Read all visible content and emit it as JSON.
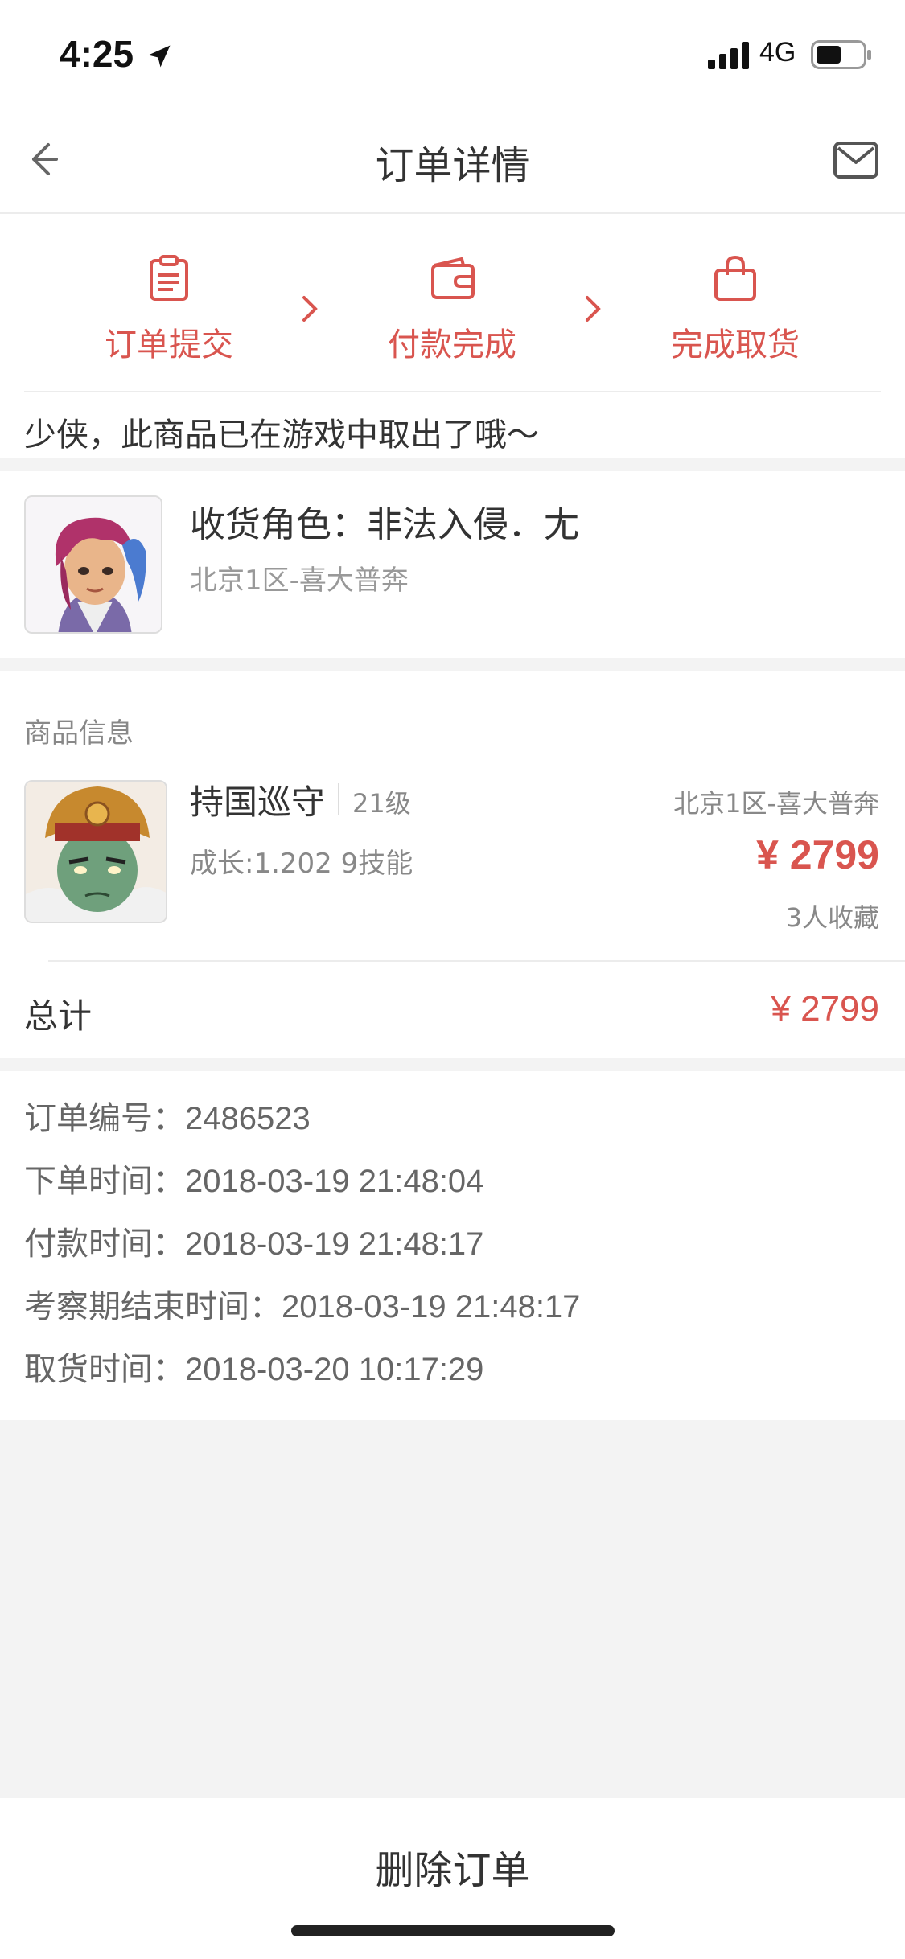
{
  "status_bar": {
    "time": "4:25",
    "network": "4G"
  },
  "nav": {
    "title": "订单详情",
    "back_icon": "back-arrow-icon",
    "mail_icon": "mail-icon"
  },
  "progress": {
    "steps": [
      {
        "label": "订单提交",
        "icon": "clipboard-icon"
      },
      {
        "label": "付款完成",
        "icon": "wallet-icon"
      },
      {
        "label": "完成取货",
        "icon": "shopping-bag-icon"
      }
    ],
    "accent_color": "#d9554f"
  },
  "notice": "少侠，此商品已在游戏中取出了哦～",
  "role": {
    "name": "收货角色：非法入侵．尢",
    "server": "北京1区-喜大普奔"
  },
  "goods": {
    "section_title": "商品信息",
    "name": "持国巡守",
    "level": "21级",
    "attributes": "成长:1.202 9技能",
    "server": "北京1区-喜大普奔",
    "price": "¥ 2799",
    "favorites": "3人收藏",
    "total_label": "总计",
    "total_value": "¥ 2799"
  },
  "order_info": {
    "rows": [
      {
        "key": "订单编号：",
        "value": "2486523"
      },
      {
        "key": "下单时间：",
        "value": "2018-03-19 21:48:04"
      },
      {
        "key": "付款时间：",
        "value": "2018-03-19 21:48:17"
      },
      {
        "key": "考察期结束时间：",
        "value": "2018-03-19 21:48:17"
      },
      {
        "key": "取货时间：",
        "value": "2018-03-20 10:17:29"
      }
    ]
  },
  "actions": {
    "delete_label": "删除订单"
  }
}
